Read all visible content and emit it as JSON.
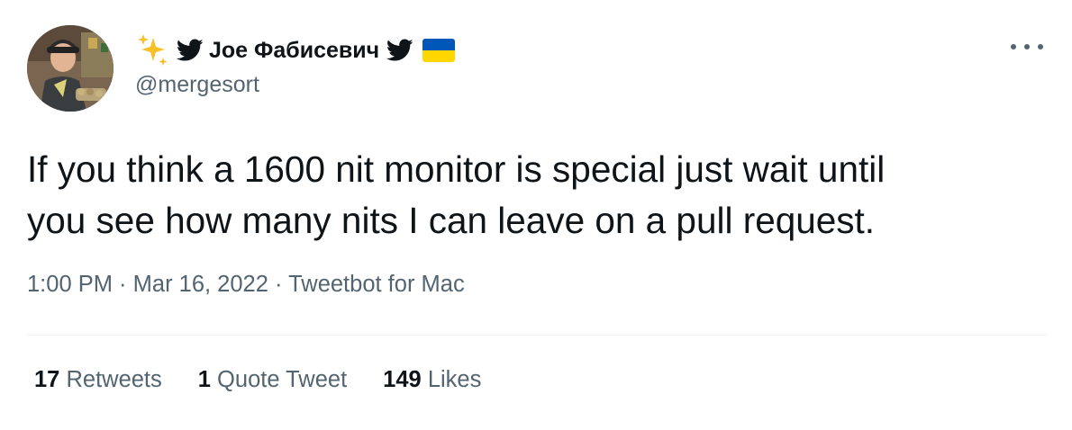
{
  "author": {
    "display_name": "Joe Фабисевич",
    "handle": "@mergesort",
    "name_emoji_prefix": [
      "sparkles-icon",
      "twitter-bird-icon"
    ],
    "name_emoji_suffix": [
      "twitter-bird-icon",
      "ukraine-flag-icon"
    ]
  },
  "tweet": {
    "text_line1": "If you think a 1600 nit monitor is special just wait until",
    "text_line2": "you see how many nits I can leave on a pull request."
  },
  "meta": {
    "time": "1:00 PM",
    "sep1": " · ",
    "date": "Mar 16, 2022",
    "sep2": " · ",
    "source": "Tweetbot for Mac"
  },
  "stats": {
    "retweets_count": "17",
    "retweets_label": "Retweets",
    "quotes_count": "1",
    "quotes_label": "Quote Tweet",
    "likes_count": "149",
    "likes_label": "Likes"
  },
  "colors": {
    "text_primary": "#0f1419",
    "text_secondary": "#536471",
    "divider": "#eff3f4",
    "flag_blue": "#0057b7",
    "flag_yellow": "#ffd700",
    "sparkle": "#f6c026"
  }
}
